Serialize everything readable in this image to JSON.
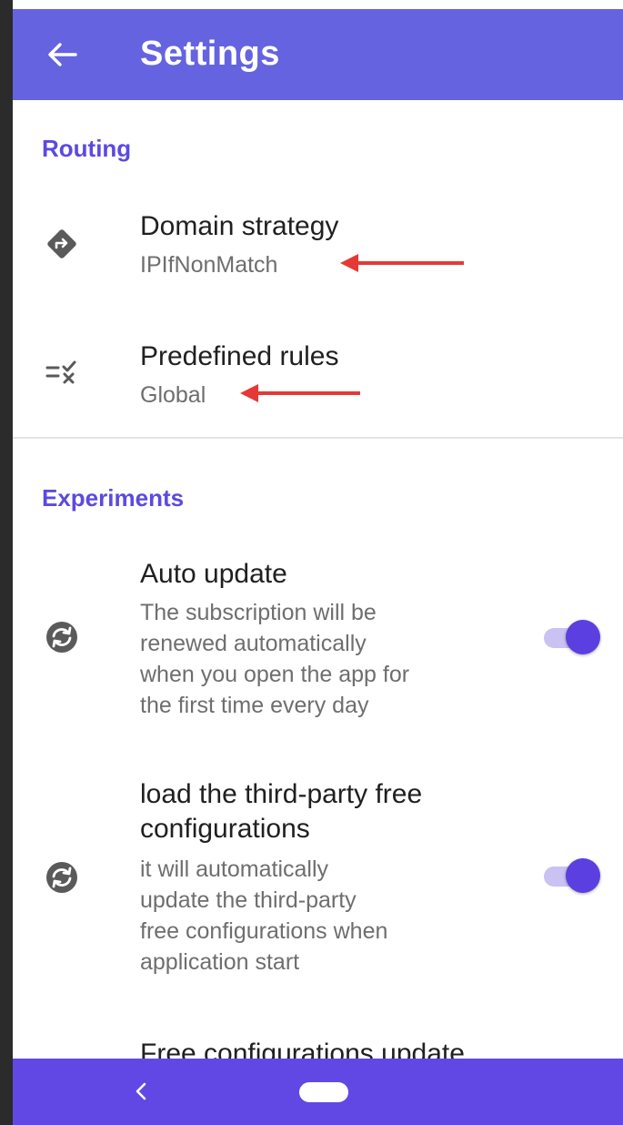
{
  "appbar": {
    "title": "Settings",
    "back_icon": "arrow-left-icon"
  },
  "sections": {
    "routing": {
      "header": "Routing",
      "domain_strategy": {
        "title": "Domain strategy",
        "summary": "IPIfNonMatch",
        "icon": "directions-diamond-icon"
      },
      "predefined_rules": {
        "title": "Predefined rules",
        "summary": "Global",
        "icon": "rule-list-icon"
      }
    },
    "experiments": {
      "header": "Experiments",
      "auto_update": {
        "title": "Auto update",
        "summary_lines": [
          "The subscription will be",
          "renewed automatically",
          "when you open the app for",
          "the first time every day"
        ],
        "icon": "sync-icon",
        "enabled": true
      },
      "third_party": {
        "title_lines": [
          "load the third-party free",
          "configurations"
        ],
        "summary_lines": [
          "it will automatically",
          "update the third-party",
          "free configurations when",
          "application start"
        ],
        "icon": "sync-icon",
        "enabled": true
      },
      "free_config_update": {
        "title": "Free configurations update"
      }
    }
  },
  "colors": {
    "appbar": "#6563e0",
    "accent": "#5b4ae0",
    "navbar": "#6148e4",
    "annotation_arrow": "#e53935"
  },
  "navbar": {
    "back_icon": "chevron-left-icon",
    "home_icon": "home-pill-icon"
  }
}
